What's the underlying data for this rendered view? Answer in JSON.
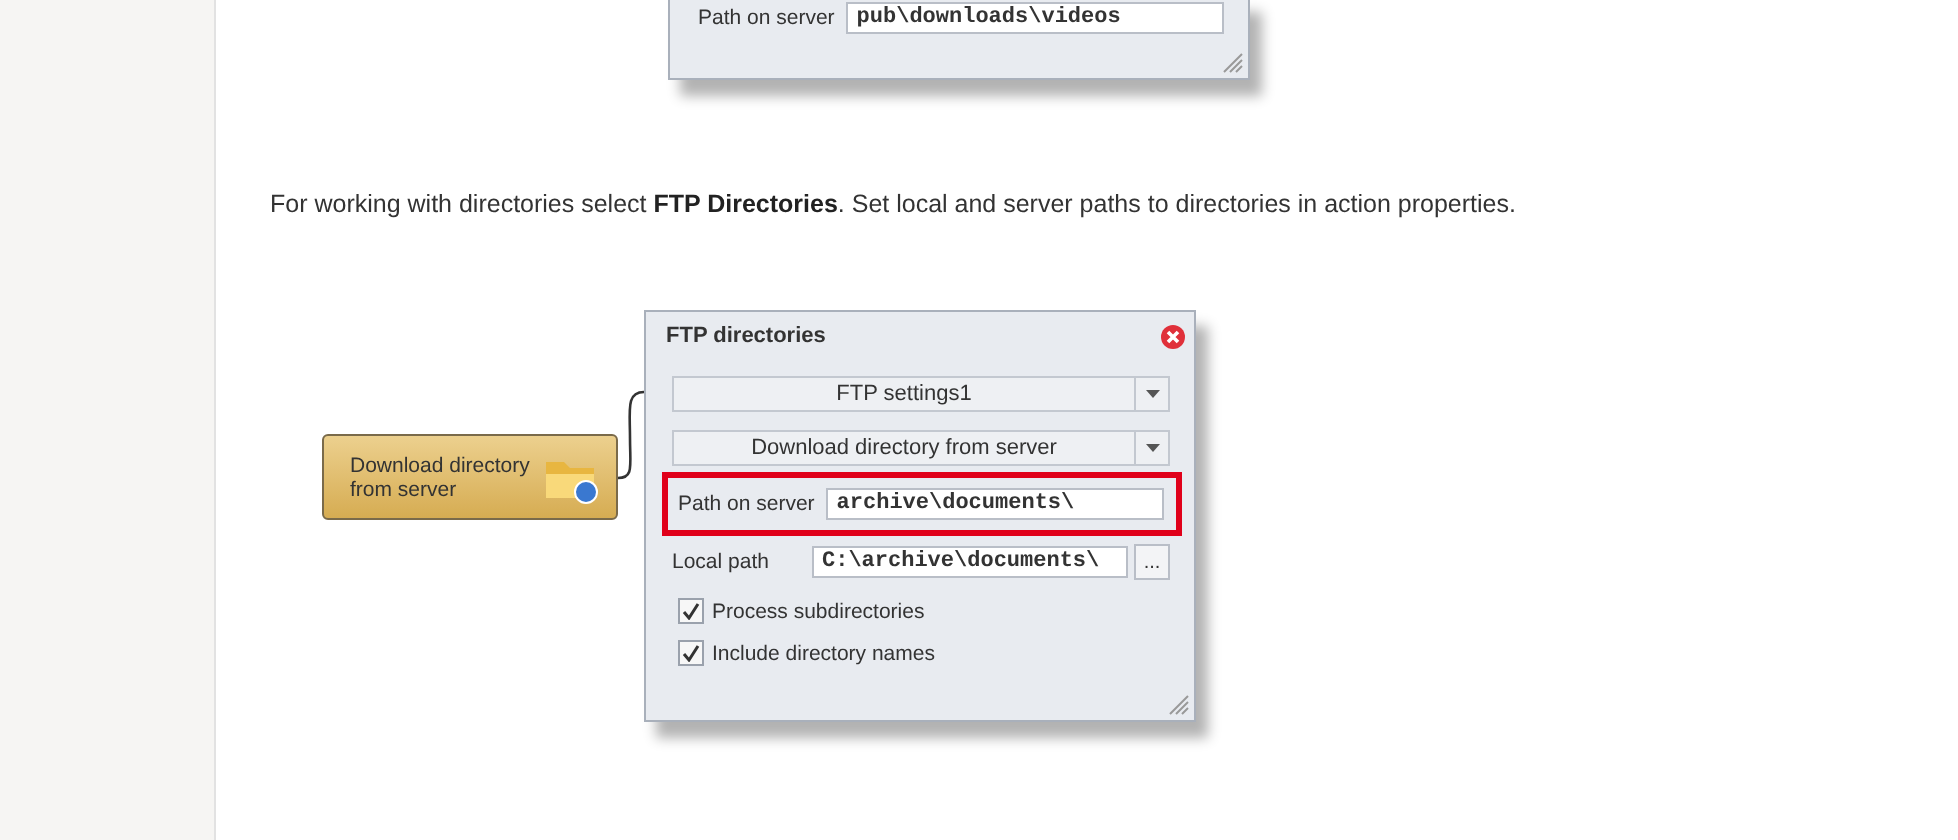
{
  "top_dialog": {
    "path_label": "Path on server",
    "path_value": "pub\\downloads\\videos"
  },
  "paragraph": "For working with directories select **FTP Directories**. Set local and server paths to directories in action properties.",
  "node": {
    "label": "Download directory from server"
  },
  "dialog": {
    "title": "FTP directories",
    "settings_select": "FTP settings1",
    "action_select": "Download directory from server",
    "path_on_server": {
      "label": "Path on server",
      "value": "archive\\documents\\",
      "highlighted": true
    },
    "local_path": {
      "label": "Local path",
      "value": "C:\\archive\\documents\\",
      "browse": "..."
    },
    "options": [
      {
        "label": "Process subdirectories",
        "checked": true
      },
      {
        "label": "Include directory names",
        "checked": true
      }
    ]
  }
}
